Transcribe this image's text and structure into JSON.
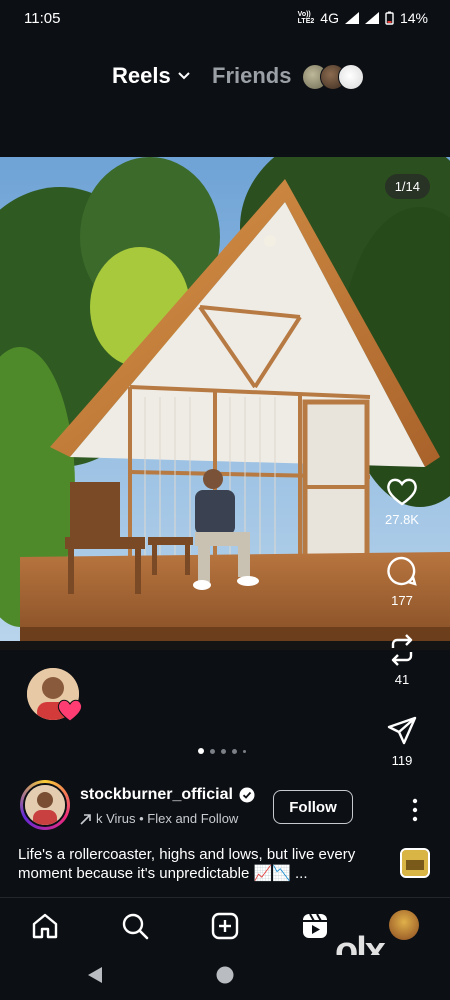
{
  "status_bar": {
    "time": "11:05",
    "volte": "VoLTE2",
    "network": "4G",
    "battery": "14%"
  },
  "header": {
    "reels_label": "Reels",
    "friends_label": "Friends"
  },
  "post": {
    "page_counter": "1/14",
    "likes": "27.8K",
    "comments": "177",
    "reposts": "41",
    "shares": "119",
    "carousel_pages": 5,
    "carousel_active": 0
  },
  "user": {
    "username": "stockburner_official",
    "audio_text": "k Virus • Flex and Follow",
    "follow_label": "Follow",
    "caption": "Life's a rollercoaster, highs and lows, but live every moment because it's unpredictable 📈📉 ..."
  },
  "watermark": "olx",
  "colors": {
    "background": "#0c0f14",
    "heart": "#ff3d72",
    "verified": "#ffffff"
  },
  "icons": [
    "chevron-down-icon",
    "heart-icon",
    "comment-icon",
    "repost-icon",
    "share-icon",
    "more-icon",
    "home-icon",
    "search-icon",
    "create-icon",
    "reels-icon",
    "back-icon",
    "home-circle-icon"
  ]
}
